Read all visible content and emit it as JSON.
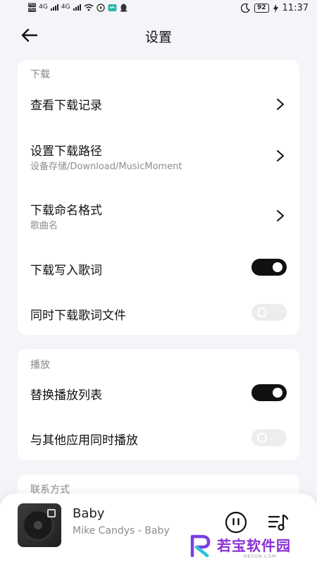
{
  "status_bar": {
    "hd1": "HD",
    "hd2": "HD",
    "net1": "4G",
    "net2": "4G",
    "battery": "92",
    "time": "11:37"
  },
  "header": {
    "title": "设置"
  },
  "download_section": {
    "title": "下载",
    "items": [
      {
        "label": "查看下载记录"
      },
      {
        "label": "设置下载路径",
        "sub": "设备存储/Download/MusicMoment"
      },
      {
        "label": "下载命名格式",
        "sub": "歌曲名"
      },
      {
        "label": "下载写入歌词",
        "toggle": "on"
      },
      {
        "label": "同时下载歌词文件",
        "toggle": "off"
      }
    ]
  },
  "playback_section": {
    "title": "播放",
    "items": [
      {
        "label": "替换播放列表",
        "toggle": "on"
      },
      {
        "label": "与其他应用同时播放",
        "toggle": "off"
      }
    ]
  },
  "contact_section": {
    "title": "联系方式"
  },
  "player": {
    "song": "Baby",
    "artist": "Mike Candys - Baby"
  },
  "watermark": {
    "text": "若宝软件园",
    "small": "RBSGN.COM"
  },
  "colors": {
    "accent": "#111111",
    "background": "#f4f5f8",
    "watermark": "#8b2fd6"
  }
}
